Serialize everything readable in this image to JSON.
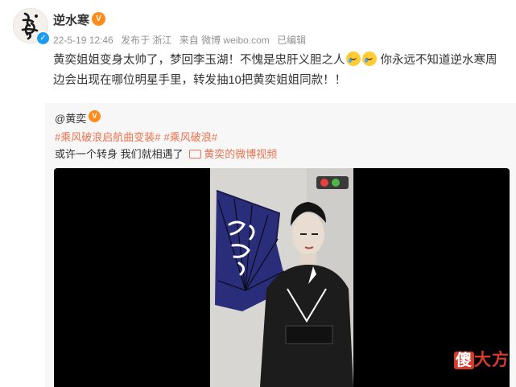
{
  "post": {
    "username": "逆水寒",
    "meta": {
      "date": "22-5-19 12:46",
      "location": "发布于 浙江",
      "source": "来自 微博 weibo.com",
      "edited": "已编辑"
    },
    "text": {
      "part1": "黄奕姐姐变身太帅了，梦回李玉湖！不愧是忠肝义胆之人",
      "part2": "你永远不知道逆水寒周",
      "line2": "边会出现在哪位明星手里，转发抽10把黄奕姐姐同款！！"
    }
  },
  "repost": {
    "author": "@黄奕",
    "hashtags": [
      "#乘风破浪启航曲变装#",
      "#乘风破浪#"
    ],
    "text": "或许一个转身 我们就相遇了",
    "video_link": "黄奕的微博视频"
  },
  "watermark": {
    "first": "傻",
    "rest": "大方"
  },
  "colors": {
    "hashtag": "#eb7350",
    "verified": "#1c9bf0",
    "vip": "#ff8c1a",
    "video_bg": "#000000",
    "watermark": "#d43b2b"
  },
  "icons": {
    "verified": "verified-check-icon",
    "vip": "vip-badge-icon",
    "emoji": "crying-laughing-emoji-icon",
    "video": "video-icon"
  }
}
